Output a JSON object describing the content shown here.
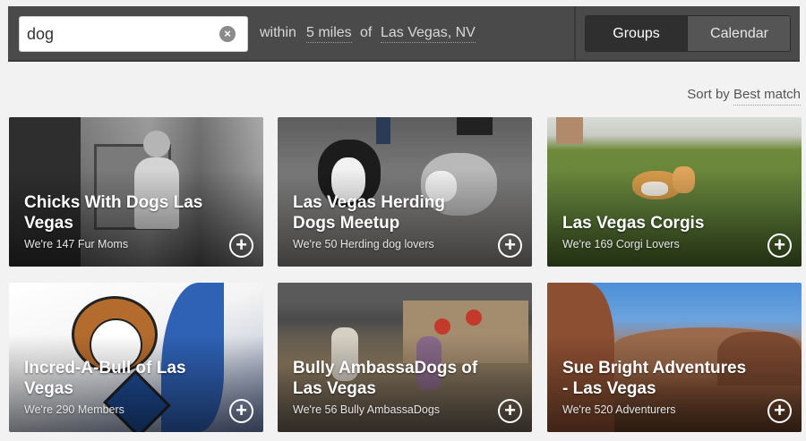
{
  "search": {
    "value": "dog",
    "clear_icon": "clear-icon",
    "within_label": "within",
    "distance": "5 miles",
    "of_label": "of",
    "location": "Las Vegas, NV"
  },
  "view_toggle": {
    "groups_label": "Groups",
    "calendar_label": "Calendar",
    "selected": "Groups"
  },
  "sort": {
    "label": "Sort by",
    "value": "Best match"
  },
  "cards": [
    {
      "title": "Chicks With Dogs Las Vegas",
      "members": "We're 147 Fur Moms",
      "join_icon": "plus-circle-icon"
    },
    {
      "title": "Las Vegas Herding Dogs Meetup",
      "members": "We're 50 Herding dog lovers",
      "join_icon": "plus-circle-icon"
    },
    {
      "title": "Las Vegas Corgis",
      "members": "We're 169 Corgi Lovers",
      "join_icon": "plus-circle-icon"
    },
    {
      "title": "Incred-A-Bull of Las Vegas",
      "members": "We're 290 Members",
      "join_icon": "plus-circle-icon"
    },
    {
      "title": "Bully AmbassaDogs of Las Vegas",
      "members": "We're 56 Bully AmbassaDogs",
      "join_icon": "plus-circle-icon"
    },
    {
      "title": "Sue Bright Adventures - Las Vegas",
      "members": "We're 520 Adventurers",
      "join_icon": "plus-circle-icon"
    }
  ],
  "join_glyph": "+",
  "clear_glyph": "×"
}
